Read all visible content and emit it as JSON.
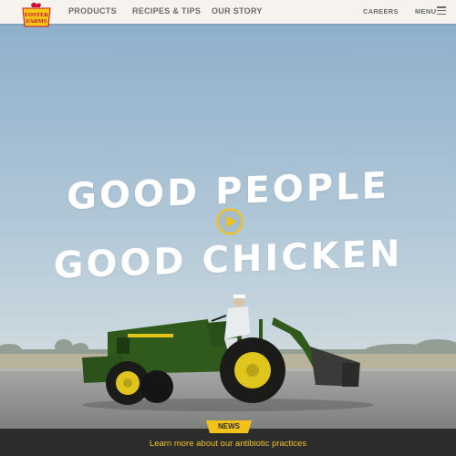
{
  "header": {
    "logo_text": "FOSTER FARMS",
    "nav": {
      "products": "PRODUCTS",
      "recipes": "RECIPES & TIPS",
      "story": "OUR STORY",
      "careers": "CAREERS",
      "menu": "MENU"
    }
  },
  "hero": {
    "headline_line1": "GOOD PEOPLE",
    "headline_line2": "GOOD CHICKEN"
  },
  "news": {
    "badge": "NEWS",
    "link_text": "Learn more about our antibiotic practices"
  },
  "colors": {
    "accent_yellow": "#f2c21b",
    "header_bg": "#f6f3ee",
    "news_bar_bg": "#2c2c2c",
    "tractor_green": "#2f5a1c"
  },
  "icons": [
    "foster-farms-logo",
    "play-icon",
    "hamburger-menu-icon"
  ]
}
